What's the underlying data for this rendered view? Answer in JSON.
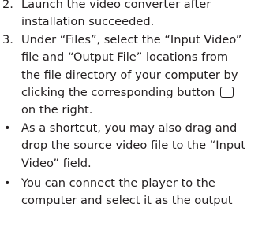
{
  "steps": [
    {
      "marker": "2.",
      "lines": [
        "Launch the video converter after",
        "installation succeeded."
      ]
    },
    {
      "marker": "3.",
      "lines": [
        "Under “Files”, select the “Input Video”",
        "file and “Output File” locations from",
        "the file directory of your computer by",
        "clicking the corresponding button",
        "on the right."
      ],
      "button_icon": "ellipsis-button-icon",
      "button_glyph": "..."
    }
  ],
  "bullets": [
    {
      "marker": "•",
      "lines": [
        "As a shortcut, you may also drag and",
        "drop the source video file to the “Input",
        "Video” field."
      ]
    },
    {
      "marker": "•",
      "lines": [
        "You can connect the player to the",
        "computer and select it as the output"
      ]
    }
  ]
}
